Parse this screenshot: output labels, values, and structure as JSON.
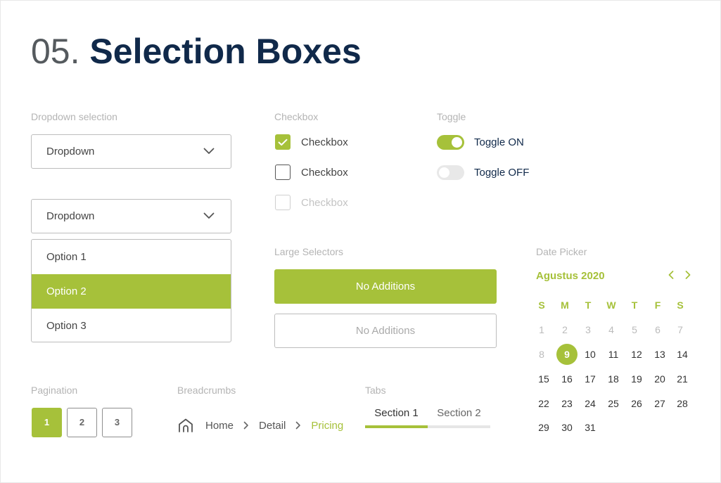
{
  "header": {
    "number": "05.",
    "title": "Selection Boxes"
  },
  "labels": {
    "dropdown": "Dropdown selection",
    "checkbox": "Checkbox",
    "toggle": "Toggle",
    "large_selectors": "Large Selectors",
    "date_picker": "Date Picker",
    "pagination": "Pagination",
    "breadcrumbs": "Breadcrumbs",
    "tabs": "Tabs"
  },
  "dropdown": {
    "closed_value": "Dropdown",
    "open_value": "Dropdown",
    "options": [
      "Option 1",
      "Option 2",
      "Option 3"
    ],
    "selected_option": "Option 2",
    "chevron_icon": "chevron-down-icon"
  },
  "checkboxes": [
    {
      "label": "Checkbox",
      "state": "checked"
    },
    {
      "label": "Checkbox",
      "state": "unchecked"
    },
    {
      "label": "Checkbox",
      "state": "disabled"
    }
  ],
  "toggles": [
    {
      "label": "Toggle ON",
      "on": true
    },
    {
      "label": "Toggle OFF",
      "on": false
    }
  ],
  "large_selectors": [
    {
      "label": "No Additions",
      "active": true
    },
    {
      "label": "No Additions",
      "active": false
    }
  ],
  "pagination": {
    "pages": [
      "1",
      "2",
      "3"
    ],
    "current": "1"
  },
  "breadcrumbs": {
    "home_icon": "home-icon",
    "separator_icon": "chevron-right-icon",
    "items": [
      "Home",
      "Detail",
      "Pricing"
    ],
    "current": "Pricing"
  },
  "tabs": {
    "items": [
      "Section 1",
      "Section 2"
    ],
    "active": "Section 1"
  },
  "date_picker": {
    "month": "Agustus 2020",
    "prev_icon": "chevron-left-icon",
    "next_icon": "chevron-right-icon",
    "weekdays": [
      "S",
      "M",
      "T",
      "W",
      "T",
      "F",
      "S"
    ],
    "prev_month_days": [
      "1",
      "2",
      "3",
      "4",
      "5",
      "6",
      "7",
      "8"
    ],
    "days": [
      "9",
      "10",
      "11",
      "12",
      "13",
      "14",
      "15",
      "16",
      "17",
      "18",
      "19",
      "20",
      "21",
      "22",
      "23",
      "24",
      "25",
      "26",
      "27",
      "28",
      "29",
      "30",
      "31"
    ],
    "selected": "9"
  },
  "colors": {
    "accent": "#a6c13a",
    "title": "#10294a",
    "label": "#b4b4b4",
    "border": "#bdbdbd"
  }
}
